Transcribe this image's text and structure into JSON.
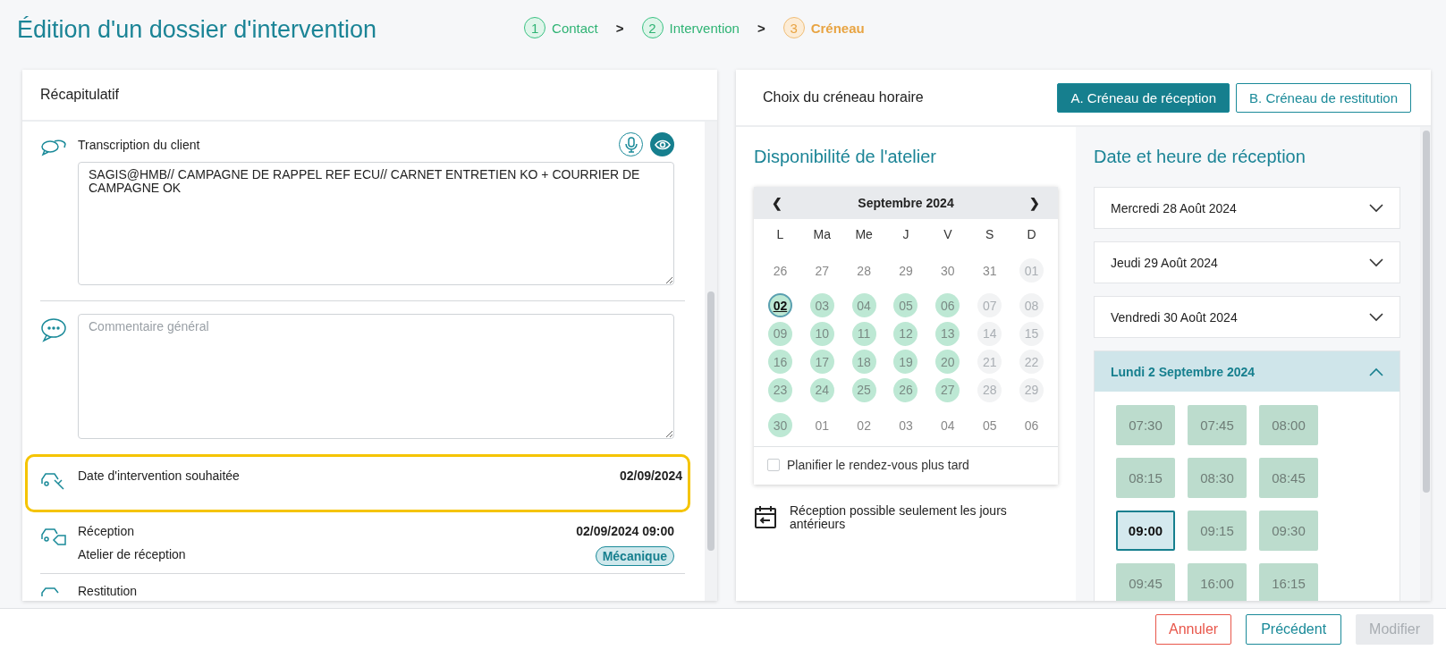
{
  "page_title": "Édition d'un dossier d'intervention",
  "steps": [
    {
      "number": "1",
      "label": "Contact",
      "selected": false
    },
    {
      "number": "2",
      "label": "Intervention",
      "selected": false
    },
    {
      "number": "3",
      "label": "Créneau",
      "selected": true
    }
  ],
  "step_separator": ">",
  "summary": {
    "title": "Récapitulatif",
    "items": [
      {
        "kind": "transcript",
        "label": "Transcription du client",
        "value": "SAGIS@HMB// CAMPAGNE DE RAPPEL REF ECU// CARNET ENTRETIEN KO + COURRIER DE CAMPAGNE OK",
        "highlighted": false
      },
      {
        "kind": "comment",
        "placeholder": "Commentaire général",
        "highlighted": false
      },
      {
        "kind": "date",
        "label": "Date d'intervention souhaitée",
        "value": "02/09/2024",
        "highlighted": true
      },
      {
        "kind": "reception",
        "label": "Réception",
        "value": "02/09/2024 09:00",
        "sublabel": "Atelier de réception",
        "badge": "Mécanique",
        "highlighted": false
      },
      {
        "kind": "restitution",
        "label": "Restitution",
        "highlighted": false
      }
    ]
  },
  "slot_panel": {
    "title": "Choix du créneau horaire",
    "tabs": [
      {
        "label": "A. Créneau de réception",
        "selected": true
      },
      {
        "label": "B. Créneau de restitution",
        "selected": false
      }
    ]
  },
  "availability": {
    "title": "Disponibilité de l'atelier",
    "calendar": {
      "prev": "❮",
      "month": "Septembre 2024",
      "next": "❯",
      "weekdays": [
        "L",
        "Ma",
        "Me",
        "J",
        "V",
        "S",
        "D"
      ],
      "days": [
        {
          "label": "26",
          "kind": "outside",
          "selected": false
        },
        {
          "label": "27",
          "kind": "outside",
          "selected": false
        },
        {
          "label": "28",
          "kind": "outside",
          "selected": false
        },
        {
          "label": "29",
          "kind": "outside",
          "selected": false
        },
        {
          "label": "30",
          "kind": "outside",
          "selected": false
        },
        {
          "label": "31",
          "kind": "outside",
          "selected": false
        },
        {
          "label": "01",
          "kind": "closed",
          "selected": false
        },
        {
          "label": "02",
          "kind": "open",
          "selected": true
        },
        {
          "label": "03",
          "kind": "open",
          "selected": false
        },
        {
          "label": "04",
          "kind": "open",
          "selected": false
        },
        {
          "label": "05",
          "kind": "open",
          "selected": false
        },
        {
          "label": "06",
          "kind": "open",
          "selected": false
        },
        {
          "label": "07",
          "kind": "closed",
          "selected": false
        },
        {
          "label": "08",
          "kind": "closed",
          "selected": false
        },
        {
          "label": "09",
          "kind": "open",
          "selected": false
        },
        {
          "label": "10",
          "kind": "open",
          "selected": false
        },
        {
          "label": "11",
          "kind": "open",
          "selected": false
        },
        {
          "label": "12",
          "kind": "open",
          "selected": false
        },
        {
          "label": "13",
          "kind": "open",
          "selected": false
        },
        {
          "label": "14",
          "kind": "closed",
          "selected": false
        },
        {
          "label": "15",
          "kind": "closed",
          "selected": false
        },
        {
          "label": "16",
          "kind": "open",
          "selected": false
        },
        {
          "label": "17",
          "kind": "open",
          "selected": false
        },
        {
          "label": "18",
          "kind": "open",
          "selected": false
        },
        {
          "label": "19",
          "kind": "open",
          "selected": false
        },
        {
          "label": "20",
          "kind": "open",
          "selected": false
        },
        {
          "label": "21",
          "kind": "closed",
          "selected": false
        },
        {
          "label": "22",
          "kind": "closed",
          "selected": false
        },
        {
          "label": "23",
          "kind": "open",
          "selected": false
        },
        {
          "label": "24",
          "kind": "open",
          "selected": false
        },
        {
          "label": "25",
          "kind": "open",
          "selected": false
        },
        {
          "label": "26",
          "kind": "open",
          "selected": false
        },
        {
          "label": "27",
          "kind": "open",
          "selected": false
        },
        {
          "label": "28",
          "kind": "closed",
          "selected": false
        },
        {
          "label": "29",
          "kind": "closed",
          "selected": false
        },
        {
          "label": "30",
          "kind": "open",
          "selected": false
        },
        {
          "label": "01",
          "kind": "outside",
          "selected": false
        },
        {
          "label": "02",
          "kind": "outside",
          "selected": false
        },
        {
          "label": "03",
          "kind": "outside",
          "selected": false
        },
        {
          "label": "04",
          "kind": "outside",
          "selected": false
        },
        {
          "label": "05",
          "kind": "outside",
          "selected": false
        },
        {
          "label": "06",
          "kind": "outside",
          "selected": false
        }
      ],
      "later": {
        "label": "Planifier le rendez-vous plus tard",
        "checked": false
      }
    },
    "note": "Réception possible seulement les jours antérieurs"
  },
  "reception": {
    "title": "Date et heure de réception",
    "days": [
      {
        "label": "Mercredi 28 Août 2024",
        "expanded": false
      },
      {
        "label": "Jeudi 29 Août 2024",
        "expanded": false
      },
      {
        "label": "Vendredi 30 Août 2024",
        "expanded": false
      },
      {
        "label": "Lundi 2 Septembre 2024",
        "expanded": true,
        "slots": [
          {
            "label": "07:30",
            "selected": false
          },
          {
            "label": "07:45",
            "selected": false
          },
          {
            "label": "08:00",
            "selected": false
          },
          {
            "label": "08:15",
            "selected": false
          },
          {
            "label": "08:30",
            "selected": false
          },
          {
            "label": "08:45",
            "selected": false
          },
          {
            "label": "09:00",
            "selected": true
          },
          {
            "label": "09:15",
            "selected": false
          },
          {
            "label": "09:30",
            "selected": false
          },
          {
            "label": "09:45",
            "selected": false
          },
          {
            "label": "16:00",
            "selected": false
          },
          {
            "label": "16:15",
            "selected": false
          }
        ]
      }
    ]
  },
  "footer": [
    {
      "label": "Annuler",
      "kind": "cancel",
      "disabled": false
    },
    {
      "label": "Précédent",
      "kind": "secondary",
      "disabled": false
    },
    {
      "label": "Modifier",
      "kind": "primary",
      "disabled": true
    }
  ]
}
